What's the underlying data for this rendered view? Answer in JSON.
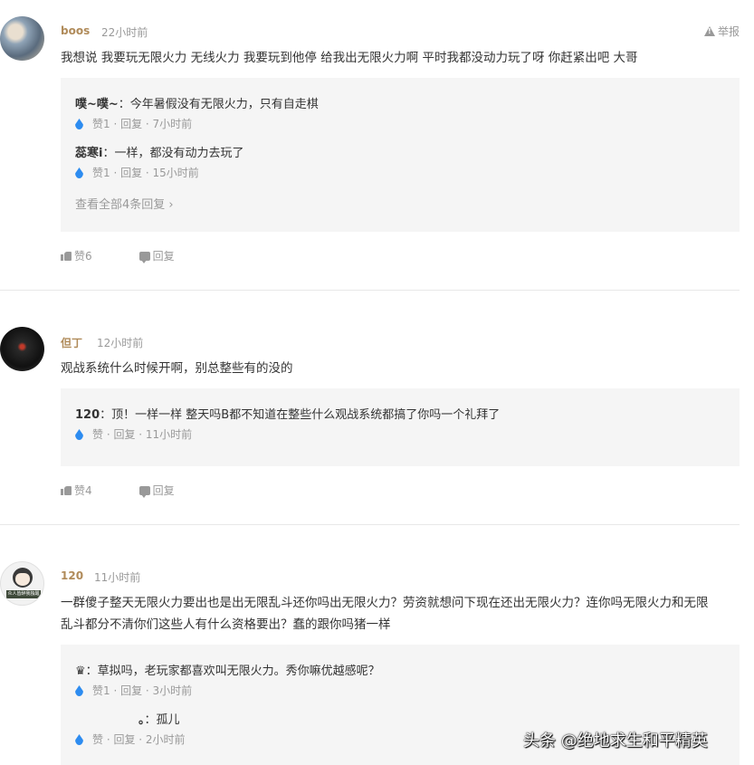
{
  "report_label": "举报",
  "comments": [
    {
      "user": "boos",
      "time": "22小时前",
      "text": "我想说 我要玩无限火力 无线火力 我要玩到他停 给我出无限火力啊 平时我都没动力玩了呀 你赶紧出吧 大哥",
      "replies": [
        {
          "name": "噗~噗~",
          "text": "：今年暑假没有无限火力，只有自走棋",
          "meta": "赞1 · 回复 · 7小时前"
        },
        {
          "name": "蕊寒i",
          "text": "：一样，都没有动力去玩了",
          "meta": "赞1 · 回复 · 15小时前"
        }
      ],
      "view_all": "查看全部4条回复",
      "like": "赞6",
      "reply": "回复"
    },
    {
      "user": "但丁",
      "time": "12小时前",
      "text": "观战系统什么时候开啊，别总整些有的没的",
      "replies": [
        {
          "name": "120",
          "text": "：顶！一样一样 整天吗B都不知道在整些什么观战系统都搞了你吗一个礼拜了",
          "meta": "赞 · 回复 · 11小时前"
        }
      ],
      "like": "赞4",
      "reply": "回复"
    },
    {
      "user": "120",
      "time": "11小时前",
      "avatar_tag": "众人皆醉我独醒",
      "text_line1": "一群傻子整天无限火力要出也是出无限乱斗还你吗出无限火力？劳资就想问下现在还出无限火力？连你吗无限火力和无限",
      "text_line2": "乱斗都分不清你们这些人有什么资格要出？蠢的跟你吗猪一样",
      "replies": [
        {
          "name": "♛",
          "text": "：草拟吗，老玩家都喜欢叫无限火力。秀你嘛优越感呢？",
          "meta": "赞1 · 回复 · 3小时前"
        },
        {
          "name": "。",
          "text": "：孤儿",
          "meta": "赞 · 回复 · 2小时前"
        }
      ]
    }
  ],
  "watermark": "头条 @绝地求生和平精英"
}
